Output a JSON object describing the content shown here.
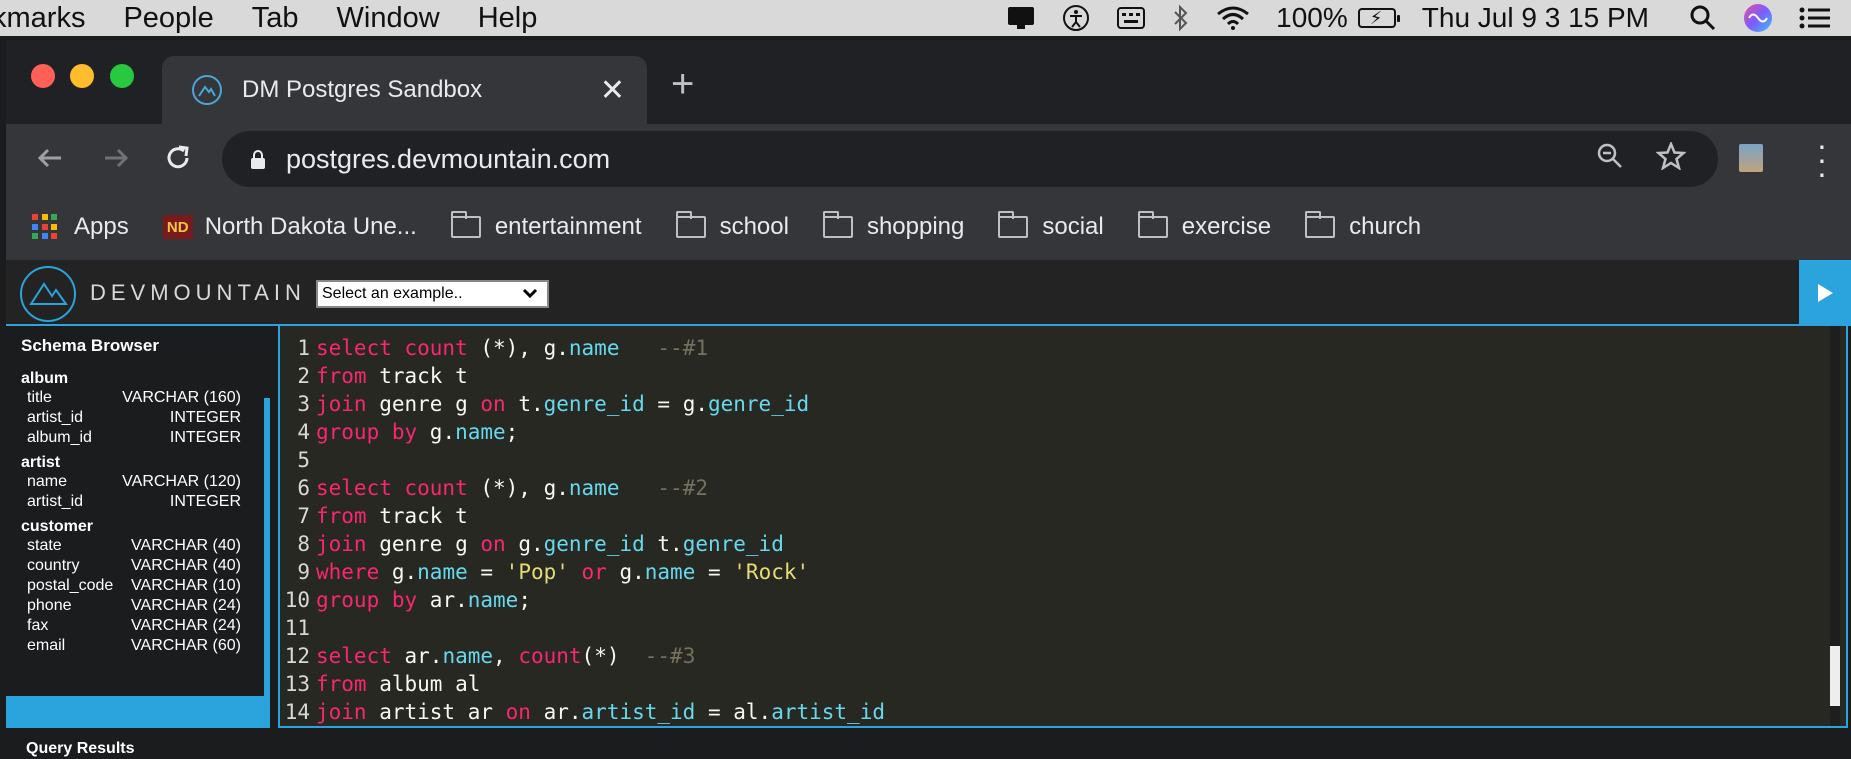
{
  "menubar": {
    "items": [
      "kmarks",
      "People",
      "Tab",
      "Window",
      "Help"
    ],
    "battery": "100%",
    "clock": "Thu Jul 9  3 15 PM"
  },
  "browser": {
    "tab_title": "DM Postgres Sandbox",
    "url": "postgres.devmountain.com",
    "bookmarks": {
      "apps": "Apps",
      "und": "North Dakota Une...",
      "und_icon_text": "ND",
      "folders": [
        "entertainment",
        "school",
        "shopping",
        "social",
        "exercise",
        "church"
      ]
    }
  },
  "app": {
    "logo": "DEVMOUNTAIN",
    "example_select": "Select an example.."
  },
  "schema": {
    "title": "Schema Browser",
    "tables": [
      {
        "name": "album",
        "columns": [
          [
            "title",
            "VARCHAR (160)"
          ],
          [
            "artist_id",
            "INTEGER"
          ],
          [
            "album_id",
            "INTEGER"
          ]
        ]
      },
      {
        "name": "artist",
        "columns": [
          [
            "name",
            "VARCHAR (120)"
          ],
          [
            "artist_id",
            "INTEGER"
          ]
        ]
      },
      {
        "name": "customer",
        "columns": [
          [
            "state",
            "VARCHAR (40)"
          ],
          [
            "country",
            "VARCHAR (40)"
          ],
          [
            "postal_code",
            "VARCHAR (10)"
          ],
          [
            "phone",
            "VARCHAR (24)"
          ],
          [
            "fax",
            "VARCHAR (24)"
          ],
          [
            "email",
            "VARCHAR (60)"
          ]
        ]
      }
    ]
  },
  "editor": {
    "lines": [
      [
        [
          "kw",
          "select count "
        ],
        [
          "tx",
          "(*), g."
        ],
        [
          "fld",
          "name"
        ],
        [
          "tx",
          "   "
        ],
        [
          "cm",
          "--#1"
        ]
      ],
      [
        [
          "kw",
          "from "
        ],
        [
          "tx",
          "track t"
        ]
      ],
      [
        [
          "kw",
          "join "
        ],
        [
          "tx",
          "genre g "
        ],
        [
          "kw",
          "on "
        ],
        [
          "tx",
          "t."
        ],
        [
          "fld",
          "genre_id"
        ],
        [
          "tx",
          " = g."
        ],
        [
          "fld",
          "genre_id"
        ]
      ],
      [
        [
          "kw",
          "group by "
        ],
        [
          "tx",
          "g."
        ],
        [
          "fld",
          "name"
        ],
        [
          "tx",
          ";"
        ]
      ],
      [],
      [
        [
          "kw",
          "select count "
        ],
        [
          "tx",
          "(*), g."
        ],
        [
          "fld",
          "name"
        ],
        [
          "tx",
          "   "
        ],
        [
          "cm",
          "--#2"
        ]
      ],
      [
        [
          "kw",
          "from "
        ],
        [
          "tx",
          "track t"
        ]
      ],
      [
        [
          "kw",
          "join "
        ],
        [
          "tx",
          "genre g "
        ],
        [
          "kw",
          "on "
        ],
        [
          "tx",
          "g."
        ],
        [
          "fld",
          "genre_id"
        ],
        [
          "tx",
          " t."
        ],
        [
          "fld",
          "genre_id"
        ]
      ],
      [
        [
          "kw",
          "where "
        ],
        [
          "tx",
          "g."
        ],
        [
          "fld",
          "name"
        ],
        [
          "tx",
          " = "
        ],
        [
          "str",
          "'Pop'"
        ],
        [
          "kw",
          " or "
        ],
        [
          "tx",
          "g."
        ],
        [
          "fld",
          "name"
        ],
        [
          "tx",
          " = "
        ],
        [
          "str",
          "'Rock'"
        ]
      ],
      [
        [
          "kw",
          "group by "
        ],
        [
          "tx",
          "ar."
        ],
        [
          "fld",
          "name"
        ],
        [
          "tx",
          ";"
        ]
      ],
      [],
      [
        [
          "kw",
          "select "
        ],
        [
          "tx",
          "ar."
        ],
        [
          "fld",
          "name"
        ],
        [
          "tx",
          ", "
        ],
        [
          "kw",
          "count"
        ],
        [
          "tx",
          "(*)  "
        ],
        [
          "cm",
          "--#3"
        ]
      ],
      [
        [
          "kw",
          "from "
        ],
        [
          "tx",
          "album al"
        ]
      ],
      [
        [
          "kw",
          "join "
        ],
        [
          "tx",
          "artist ar "
        ],
        [
          "kw",
          "on "
        ],
        [
          "tx",
          "ar."
        ],
        [
          "fld",
          "artist_id"
        ],
        [
          "tx",
          " = al."
        ],
        [
          "fld",
          "artist_id"
        ]
      ]
    ]
  },
  "results": {
    "label": "Query Results"
  }
}
